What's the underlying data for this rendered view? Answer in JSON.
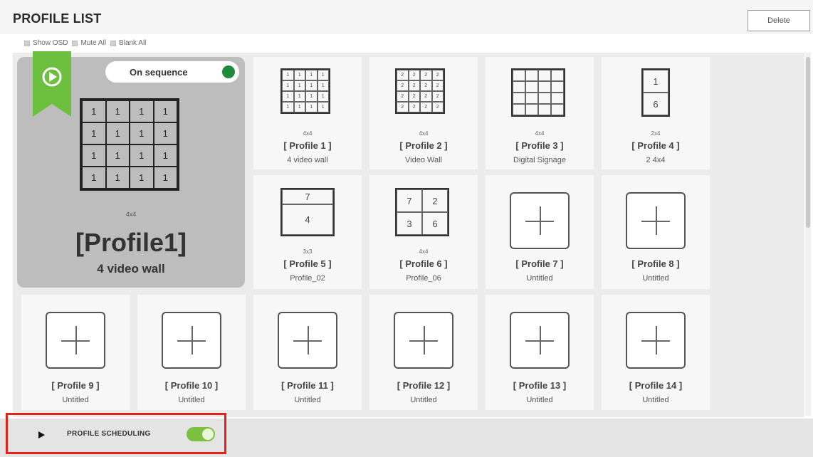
{
  "header": {
    "title": "PROFILE LIST",
    "delete_label": "Delete"
  },
  "options": [
    {
      "label": "Show OSD"
    },
    {
      "label": "Mute All"
    },
    {
      "label": "Blank All"
    }
  ],
  "active_profile": {
    "sequence_label": "On sequence",
    "dimension": "4x4",
    "name": "[Profile1]",
    "description": "4 video wall",
    "grid_values": [
      "1",
      "1",
      "1",
      "1",
      "1",
      "1",
      "1",
      "1",
      "1",
      "1",
      "1",
      "1",
      "1",
      "1",
      "1",
      "1"
    ]
  },
  "profiles": [
    {
      "label": "[ Profile 1 ]",
      "dimension": "4x4",
      "description": "4 video wall"
    },
    {
      "label": "[ Profile 2 ]",
      "dimension": "4x4",
      "description": "Video Wall"
    },
    {
      "label": "[ Profile 3 ]",
      "dimension": "4x4",
      "description": "Digital Signage"
    },
    {
      "label": "[ Profile 4 ]",
      "dimension": "2x4",
      "description": "2 4x4"
    },
    {
      "label": "[ Profile 5 ]",
      "dimension": "3x3",
      "description": "Profile_02"
    },
    {
      "label": "[ Profile 6 ]",
      "dimension": "4x4",
      "description": "Profile_06"
    },
    {
      "label": "[ Profile 7 ]",
      "description": "Untitled"
    },
    {
      "label": "[ Profile 8 ]",
      "description": "Untitled"
    },
    {
      "label": "[ Profile 9 ]",
      "description": "Untitled"
    },
    {
      "label": "[ Profile 10 ]",
      "description": "Untitled"
    },
    {
      "label": "[ Profile 11 ]",
      "description": "Untitled"
    },
    {
      "label": "[ Profile 12 ]",
      "description": "Untitled"
    },
    {
      "label": "[ Profile 13 ]",
      "description": "Untitled"
    },
    {
      "label": "[ Profile 14 ]",
      "description": "Untitled"
    }
  ],
  "thumbnails": {
    "profile1": [
      "1",
      "1",
      "1",
      "1",
      "1",
      "1",
      "1",
      "1",
      "1",
      "1",
      "1",
      "1",
      "1",
      "1",
      "1",
      "1"
    ],
    "profile2": [
      "2",
      "2",
      "2",
      "2",
      "2",
      "2",
      "2",
      "2",
      "2",
      "2",
      "2",
      "2",
      "2",
      "2",
      "2",
      "2"
    ],
    "profile4": [
      "1",
      "6"
    ],
    "profile5": [
      "7",
      "4"
    ],
    "profile6": [
      "7",
      "2",
      "3",
      "6"
    ]
  },
  "footer": {
    "scheduling_label": "PROFILE SCHEDULING",
    "scheduling_enabled": true
  },
  "colors": {
    "accent_green": "#7cc142",
    "ribbon_green": "#6cbf3f",
    "status_green": "#1f8a3b",
    "highlight_red": "#e2231a"
  },
  "icons": {
    "play": "play-icon",
    "ribbon": "play-ribbon-icon",
    "add": "plus-icon"
  }
}
